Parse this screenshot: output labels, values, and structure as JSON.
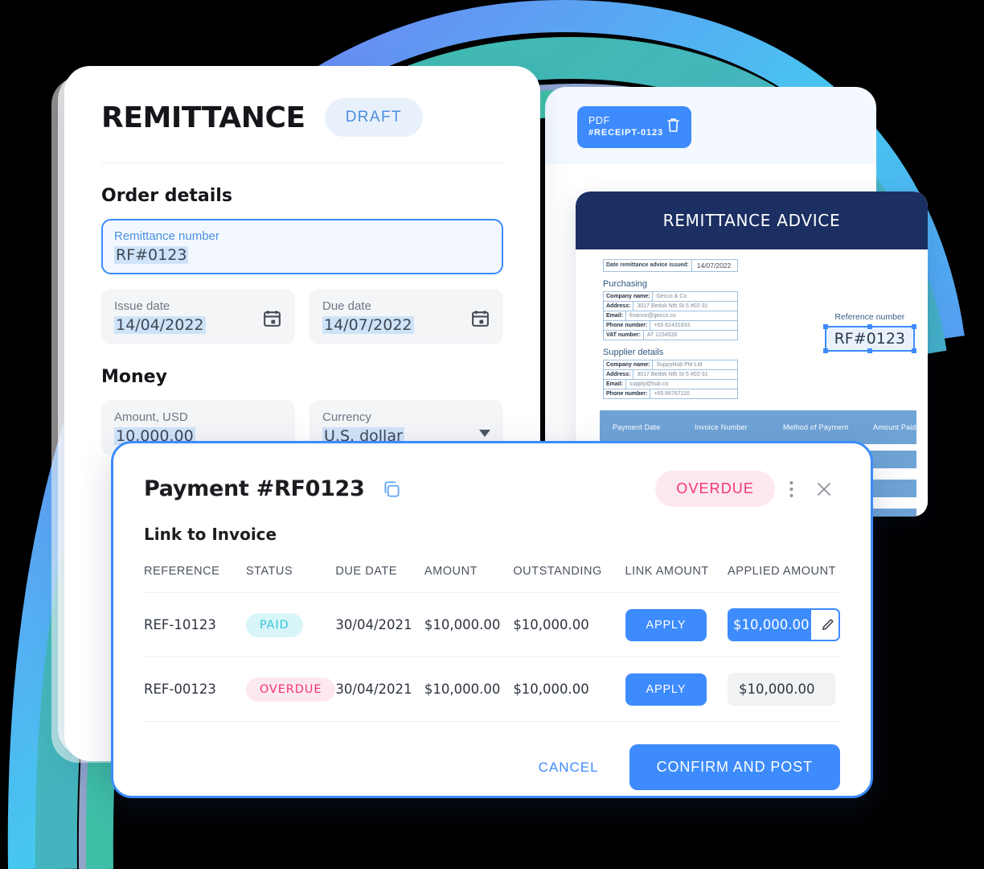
{
  "remittance_card": {
    "title": "REMITTANCE",
    "status_badge": "DRAFT",
    "order_details_heading": "Order details",
    "remittance_number": {
      "label": "Remittance number",
      "value": "RF#0123"
    },
    "issue_date": {
      "label": "Issue date",
      "value": "14/04/2022",
      "icon": "calendar-icon"
    },
    "due_date": {
      "label": "Due date",
      "value": "14/07/2022",
      "icon": "calendar-icon"
    },
    "money_heading": "Money",
    "amount": {
      "label": "Amount, USD",
      "value": "10,000.00"
    },
    "currency": {
      "label": "Currency",
      "value": "U.S. dollar",
      "icon": "chevron-down-icon"
    }
  },
  "pdf_panel": {
    "badge_line1": "PDF",
    "badge_line2": "#RECEIPT-0123",
    "delete_icon": "trash-icon"
  },
  "advice_document": {
    "header_title": "REMITTANCE ADVICE",
    "issued_label": "Date remittance advice issued:",
    "issued_value": "14/07/2022",
    "reference_label": "Reference number",
    "reference_value": "RF#0123",
    "purchasing": {
      "heading": "Purchasing",
      "rows": [
        {
          "key": "Company name:",
          "value": "Gecco & Co"
        },
        {
          "key": "Address:",
          "value": "3017 Bedok Nth St 5 #02-31"
        },
        {
          "key": "Email:",
          "value": "finance@gecco.co"
        },
        {
          "key": "Phone number:",
          "value": "+65 62431833"
        },
        {
          "key": "VAT number:",
          "value": "AT 1234535"
        }
      ]
    },
    "supplier": {
      "heading": "Supplier details",
      "rows": [
        {
          "key": "Company name:",
          "value": "SuppyHub Pte Ltd"
        },
        {
          "key": "Address:",
          "value": "3017 Bedok Nth St 5 #02-31"
        },
        {
          "key": "Email:",
          "value": "supply@hub.co"
        },
        {
          "key": "Phone number:",
          "value": "+65 89767110"
        }
      ]
    },
    "table_headers": [
      "Payment Date",
      "Invoice Number",
      "Method of Payment",
      "Amount Paid"
    ]
  },
  "payment_modal": {
    "title": "Payment #RF0123",
    "copy_icon": "copy-icon",
    "status_badge": "OVERDUE",
    "menu_icon": "kebab-menu-icon",
    "close_icon": "close-icon",
    "subtitle": "Link to Invoice",
    "table": {
      "headers": [
        "REFERENCE",
        "STATUS",
        "DUE DATE",
        "AMOUNT",
        "OUTSTANDING",
        "LINK AMOUNT",
        "APPLIED AMOUNT"
      ],
      "rows": [
        {
          "reference": "REF-10123",
          "status": "PAID",
          "status_kind": "paid",
          "due_date": "30/04/2021",
          "amount": "$10,000.00",
          "outstanding": "$10,000.00",
          "link_label": "APPLY",
          "applied_amount": "$10,000.00",
          "applied_editing": true,
          "edit_icon": "pencil-icon"
        },
        {
          "reference": "REF-00123",
          "status": "OVERDUE",
          "status_kind": "overdue",
          "due_date": "30/04/2021",
          "amount": "$10,000.00",
          "outstanding": "$10,000.00",
          "link_label": "APPLY",
          "applied_amount": "$10,000.00",
          "applied_editing": false,
          "edit_icon": ""
        }
      ]
    },
    "cancel_label": "CANCEL",
    "confirm_label": "CONFIRM AND POST"
  },
  "colors": {
    "accent_blue": "#3d8bfd",
    "draft_blue": "#4a8fe0",
    "paid_teal": "#38c6d9",
    "overdue_pink": "#f4376d",
    "doc_header_navy": "#1c2f63",
    "doc_table_blue": "#6fa3d6"
  }
}
